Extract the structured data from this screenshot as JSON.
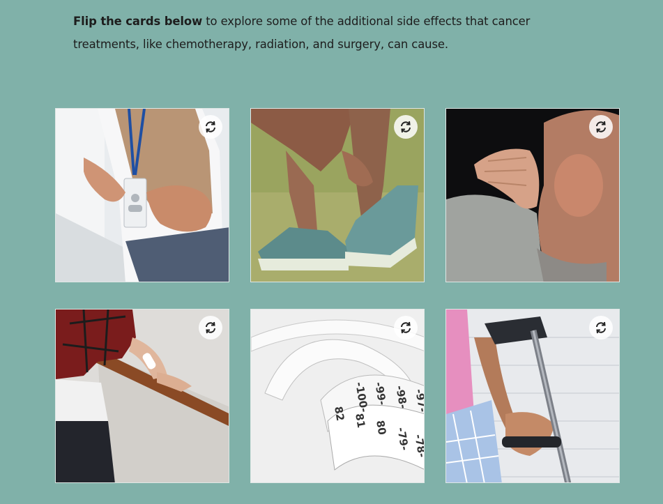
{
  "intro": {
    "bold": "Flip the cards below",
    "rest": " to explore some of the additional side effects that cancer treatments, like chemotherapy, radiation, and surgery, can cause."
  },
  "cards": [
    {
      "name": "card-stomach-pain",
      "icon": "flip-icon"
    },
    {
      "name": "card-leg-cramp",
      "icon": "flip-icon"
    },
    {
      "name": "card-neck-pain",
      "icon": "flip-icon"
    },
    {
      "name": "card-stair-railing",
      "icon": "flip-icon"
    },
    {
      "name": "card-measuring-tape",
      "icon": "flip-icon"
    },
    {
      "name": "card-forearm-crutch",
      "icon": "flip-icon"
    }
  ],
  "tape_numbers": [
    "-100-",
    "-99-",
    "-98-",
    "-97-",
    "82",
    "81",
    "80",
    "-79-",
    "-78-"
  ],
  "colors": {
    "background": "#80b1a9",
    "flip_button": "#ffffff"
  }
}
